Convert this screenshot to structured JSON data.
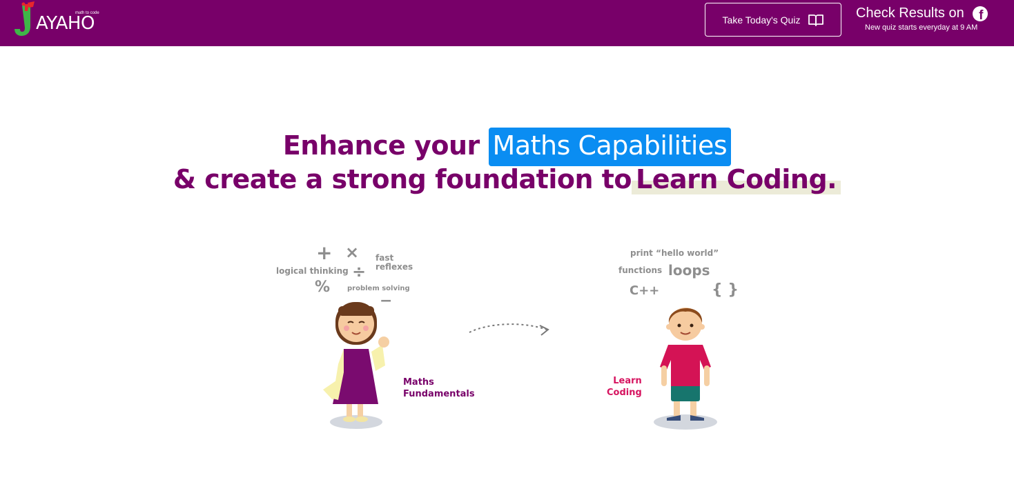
{
  "header": {
    "logo_text": "AYAHO",
    "logo_tagline": "math to code",
    "quiz_button_label": "Take Today's Quiz",
    "results_label": "Check Results on",
    "results_subtext": "New quiz starts everyday at 9 AM"
  },
  "hero": {
    "line1_prefix": "Enhance your",
    "line1_highlight": "Maths Capabilities",
    "line2_prefix": "& create a strong foundation to",
    "line2_highlight": "Learn Coding."
  },
  "maths_side": {
    "caption_line1": "Maths",
    "caption_line2": "Fundamentals",
    "words": {
      "logical": "logical thinking",
      "fast": "fast",
      "reflexes": "reflexes",
      "problem": "problem solving"
    },
    "symbols": {
      "plus": "+",
      "times": "×",
      "divide": "÷",
      "percent": "%",
      "minus": "−"
    }
  },
  "coding_side": {
    "caption_line1": "Learn",
    "caption_line2": "Coding",
    "words": {
      "print": "print “hello world”",
      "functions": "functions",
      "loops": "loops",
      "cpp": "C++",
      "braces": "{ }"
    }
  },
  "colors": {
    "brand": "#780069",
    "highlight_blue": "#0a8df2",
    "highlight_cream": "#ecebd8",
    "coding_accent": "#d6135f"
  },
  "icons": {
    "quiz": "open-book-icon",
    "results": "facebook-icon",
    "flow": "dotted-arrow-icon"
  }
}
